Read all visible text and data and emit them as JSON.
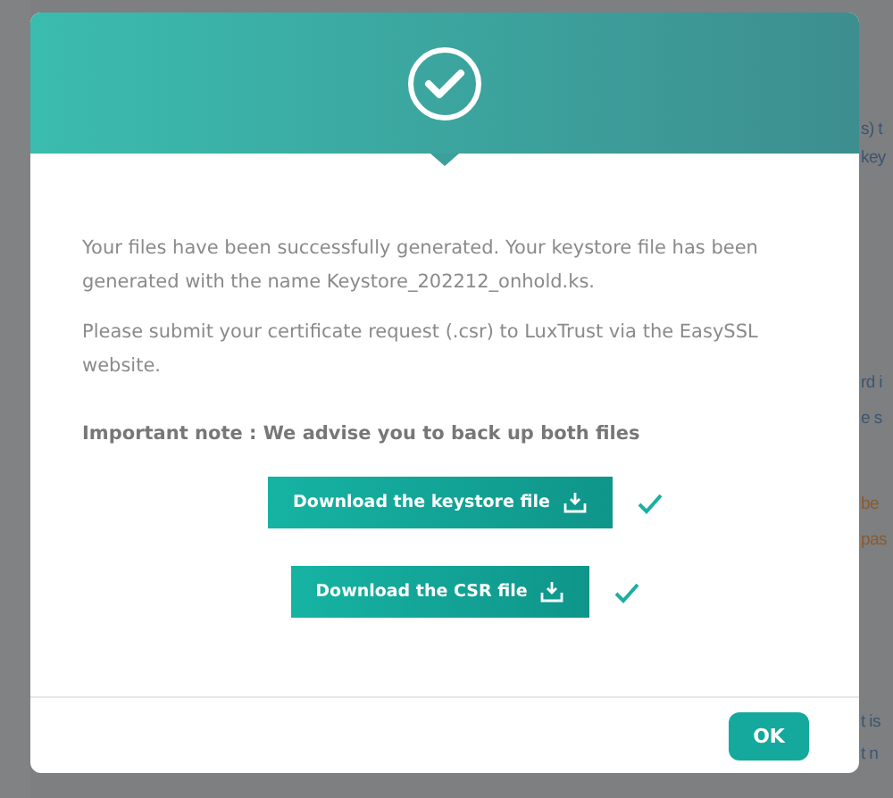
{
  "background_fragments": [
    {
      "text": "s) t",
      "color": "#3d5570"
    },
    {
      "text": "key",
      "color": "#3d5570"
    },
    {
      "text": "rd i",
      "color": "#3d5570"
    },
    {
      "text": "e s",
      "color": "#3d5570"
    },
    {
      "text": "be",
      "color": "#8a5a2e"
    },
    {
      "text": "pas",
      "color": "#8a5a2e"
    },
    {
      "text": "t is",
      "color": "#3d5570"
    },
    {
      "text": "t n",
      "color": "#3d5570"
    }
  ],
  "dialog": {
    "paragraphs": [
      "Your files have been successfully generated. Your keystore file has been generated with the name Keystore_202212_onhold.ks.",
      "Please submit your certificate request (.csr) to LuxTrust via the EasySSL website."
    ],
    "note": "Important note : We advise you to back up both files",
    "downloads": [
      {
        "label": "Download the keystore file",
        "done": true
      },
      {
        "label": "Download the CSR file",
        "done": true
      }
    ],
    "ok_button": "OK"
  }
}
